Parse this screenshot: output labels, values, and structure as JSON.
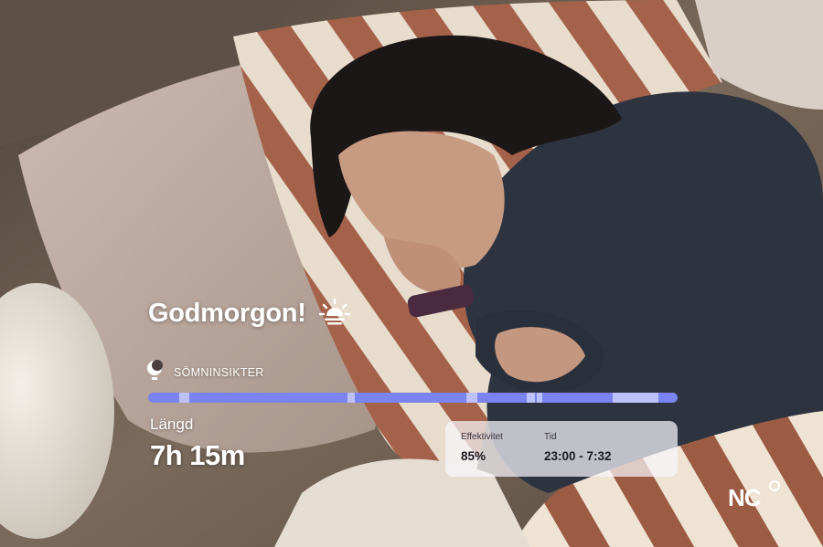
{
  "greeting": {
    "text": "Godmorgon!",
    "icon": "sunrise-icon"
  },
  "insights": {
    "label": "SÖMNINSIKTER",
    "icon": "moon-clock-icon"
  },
  "sleep_bar": {
    "color_main": "#7b83f0",
    "color_light": "#bcc2fb"
  },
  "length": {
    "label": "Längd",
    "value": "7h 15m"
  },
  "stats": {
    "efficiency_label": "Effektivitet",
    "efficiency_value": "85%",
    "time_label": "Tid",
    "time_value": "23:00 - 7:32"
  },
  "logo": {
    "text": "NC"
  }
}
